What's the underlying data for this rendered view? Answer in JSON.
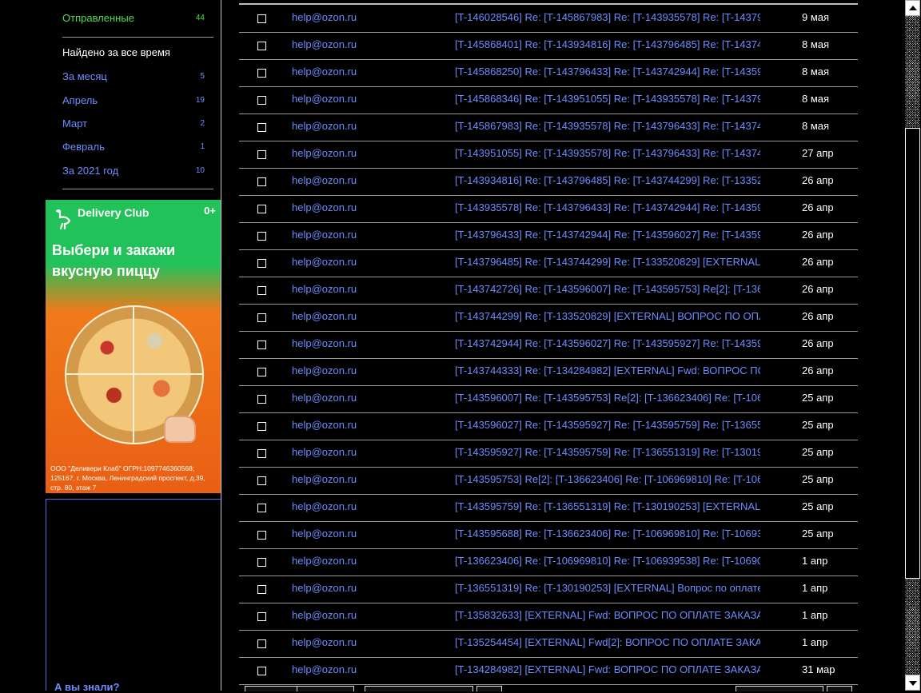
{
  "sidebar": {
    "sent": {
      "label": "Отправленные",
      "count": "44"
    },
    "found_heading": "Найдено за все время",
    "periods": [
      {
        "label": "За месяц",
        "count": "5"
      },
      {
        "label": "Апрель",
        "count": "19"
      },
      {
        "label": "Март",
        "count": "2"
      },
      {
        "label": "Февраль",
        "count": "1"
      },
      {
        "label": "За 2021 год",
        "count": "10"
      }
    ],
    "ad": {
      "brand": "Delivery Club",
      "age": "0+",
      "headline": "Выбери и закажи вкусную пиццу",
      "legal": "ООО \"Деливери Клаб\" ОГРН:1097746360568; 125167, г. Москва, Ленинградский проспект, д.39, стр. 80, этаж 7"
    },
    "did_you_know": "А вы знали?"
  },
  "messages": [
    {
      "from": "help@ozon.ru",
      "subject": "[T-146028546] Re: [T-145867983] Re: [T-143935578] Re: [T-14379",
      "date": "9 мая"
    },
    {
      "from": "help@ozon.ru",
      "subject": "[T-145868401] Re: [T-143934816] Re: [T-143796485] Re: [T-14374",
      "date": "8 мая"
    },
    {
      "from": "help@ozon.ru",
      "subject": "[T-145868250] Re: [T-143796433] Re: [T-143742944] Re: [T-14359",
      "date": "8 мая"
    },
    {
      "from": "help@ozon.ru",
      "subject": "[T-145868346] Re: [T-143951055] Re: [T-143935578] Re: [T-14379",
      "date": "8 мая"
    },
    {
      "from": "help@ozon.ru",
      "subject": "[T-145867983] Re: [T-143935578] Re: [T-143796433] Re: [T-14374",
      "date": "8 мая"
    },
    {
      "from": "help@ozon.ru",
      "subject": "[T-143951055] Re: [T-143935578] Re: [T-143796433] Re: [T-14374",
      "date": "27 апр"
    },
    {
      "from": "help@ozon.ru",
      "subject": "[T-143934816] Re: [T-143796485] Re: [T-143744299] Re: [T-13352",
      "date": "26 апр"
    },
    {
      "from": "help@ozon.ru",
      "subject": "[T-143935578] Re: [T-143796433] Re: [T-143742944] Re: [T-14359",
      "date": "26 апр"
    },
    {
      "from": "help@ozon.ru",
      "subject": "[T-143796433] Re: [T-143742944] Re: [T-143596027] Re: [T-14359",
      "date": "26 апр"
    },
    {
      "from": "help@ozon.ru",
      "subject": "[T-143796485] Re: [T-143744299] Re: [T-133520829] [EXTERNAL]",
      "date": "26 апр"
    },
    {
      "from": "help@ozon.ru",
      "subject": "[T-143742726] Re: [T-143596007] Re: [T-143595753] Re[2]: [T-136",
      "date": "26 апр"
    },
    {
      "from": "help@ozon.ru",
      "subject": "[T-143744299] Re: [T-133520829] [EXTERNAL] ВОПРОС ПО ОПЛ",
      "date": "26 апр"
    },
    {
      "from": "help@ozon.ru",
      "subject": "[T-143742944] Re: [T-143596027] Re: [T-143595927] Re: [T-14359",
      "date": "26 апр"
    },
    {
      "from": "help@ozon.ru",
      "subject": "[T-143744333] Re: [T-134284982] [EXTERNAL] Fwd: ВОПРОС ПС",
      "date": "26 апр"
    },
    {
      "from": "help@ozon.ru",
      "subject": "[T-143596007] Re: [T-143595753] Re[2]: [T-136623406] Re: [T-106",
      "date": "25 апр"
    },
    {
      "from": "help@ozon.ru",
      "subject": "[T-143596027] Re: [T-143595927] Re: [T-143595759] Re: [T-13655",
      "date": "25 апр"
    },
    {
      "from": "help@ozon.ru",
      "subject": "[T-143595927] Re: [T-143595759] Re: [T-136551319] Re: [T-13019",
      "date": "25 апр"
    },
    {
      "from": "help@ozon.ru",
      "subject": "[T-143595753] Re[2]: [T-136623406] Re: [T-106969810] Re: [T-106",
      "date": "25 апр"
    },
    {
      "from": "help@ozon.ru",
      "subject": "[T-143595759] Re: [T-136551319] Re: [T-130190253] [EXTERNAL]",
      "date": "25 апр"
    },
    {
      "from": "help@ozon.ru",
      "subject": "[T-143595688] Re: [T-136623406] Re: [T-106969810] Re: [T-10693",
      "date": "25 апр"
    },
    {
      "from": "help@ozon.ru",
      "subject": "[T-136623406] Re: [T-106969810] Re: [T-106939538] Re: [T-10690",
      "date": "1 апр"
    },
    {
      "from": "help@ozon.ru",
      "subject": "[T-136551319] Re: [T-130190253] [EXTERNAL] Вопрос по оплате",
      "date": "1 апр"
    },
    {
      "from": "help@ozon.ru",
      "subject": "[T-135832633] [EXTERNAL] Fwd: ВОПРОС ПО ОПЛАТЕ ЗАКАЗА",
      "date": "1 апр"
    },
    {
      "from": "help@ozon.ru",
      "subject": "[T-135254454] [EXTERNAL] Fwd[2]: ВОПРОС ПО ОПЛАТЕ ЗАКА",
      "date": "1 апр"
    },
    {
      "from": "help@ozon.ru",
      "subject": "[T-134284982] [EXTERNAL] Fwd: ВОПРОС ПО ОПЛАТЕ ЗАКАЗА",
      "date": "31 мар"
    }
  ]
}
